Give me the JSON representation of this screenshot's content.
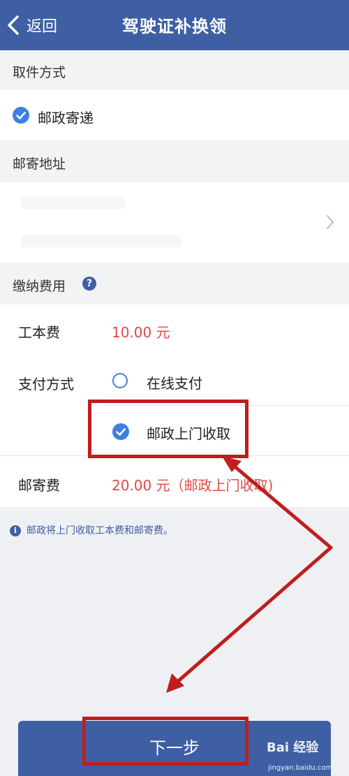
{
  "nav": {
    "back_label": "返回",
    "title": "驾驶证补换领"
  },
  "pickup": {
    "header": "取件方式",
    "option": "邮政寄递"
  },
  "address": {
    "header": "邮寄地址"
  },
  "fees": {
    "header": "缴纳费用",
    "help_glyph": "?",
    "cost_label": "工本费",
    "cost_value": "10.00 元",
    "payment_label": "支付方式",
    "payment_option_online": "在线支付",
    "payment_option_postal": "邮政上门收取",
    "postage_label": "邮寄费",
    "postage_value": "20.00 元（邮政上门收取)"
  },
  "info": {
    "glyph": "i",
    "text": "邮政将上门收取工本费和邮寄费。"
  },
  "footer": {
    "next_label": "下一步"
  },
  "watermark": {
    "brand": "Bai 经验",
    "domain": "jingyan.baidu.com"
  },
  "colors": {
    "nav_bar": "#3e5fa4",
    "accent_blue": "#3f7fe4",
    "price_red": "#e04a48",
    "annotation_red": "#bf1e1e"
  }
}
